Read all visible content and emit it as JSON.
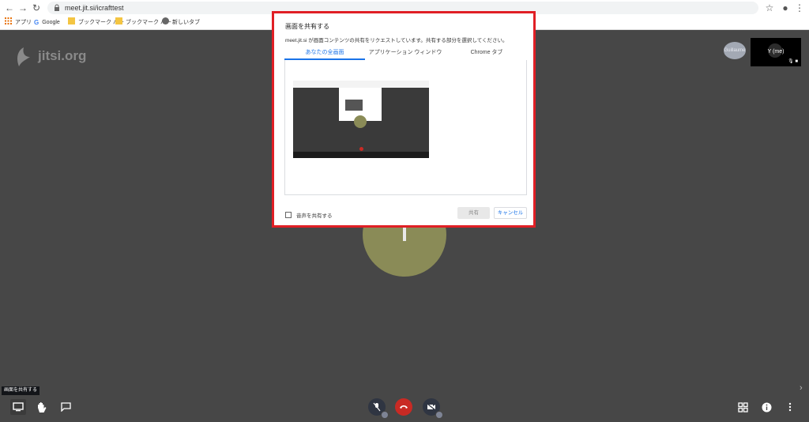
{
  "browser": {
    "url": "meet.jit.si/icrafttest",
    "bookmarks": [
      "アプリ",
      "Google",
      "ブックマーク バー",
      "ブックマーク バー",
      "新しいタブ"
    ]
  },
  "meeting": {
    "logo_text": "jitsi.org",
    "remote_participant_label": "Guillaume",
    "self_label": "Y (me)",
    "tooltip": "画面を共有する"
  },
  "dialog": {
    "title": "画面を共有する",
    "description": "meet.jit.si が画面コンテンツの共有をリクエストしています。共有する部分を選択してください。",
    "tabs": [
      "あなたの全画面",
      "アプリケーション ウィンドウ",
      "Chrome タブ"
    ],
    "selected_tab": "あなたの全画面",
    "audio_checkbox_label": "音声を共有する",
    "audio_checked": false,
    "share_button": "共有",
    "cancel_button": "キャンセル"
  },
  "colors": {
    "highlight_border": "#e01f25",
    "accent": "#1a73e8",
    "stage_bg": "#474747",
    "avatar": "#8a8b57",
    "hangup": "#c92a24"
  },
  "icons": [
    "back-icon",
    "forward-icon",
    "reload-icon",
    "lock-icon",
    "star-icon",
    "profile-icon",
    "kebab-menu-icon",
    "apps-grid-icon",
    "google-icon",
    "folder-icon",
    "globe-icon",
    "jitsi-logo-icon",
    "screen-share-icon",
    "raise-hand-icon",
    "chat-icon",
    "mic-muted-icon",
    "hangup-icon",
    "camera-off-icon",
    "tile-view-icon",
    "info-icon",
    "more-icon",
    "chevron-right-icon"
  ]
}
